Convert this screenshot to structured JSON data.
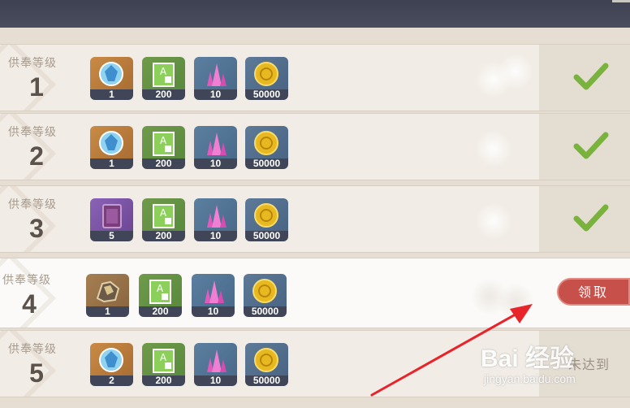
{
  "header": {
    "title": ""
  },
  "rows": [
    {
      "label": "供奉等级",
      "level": "1",
      "status": "claimed",
      "rewards": [
        {
          "icon": "blue-gem-icon",
          "qty": "1",
          "bg": "orange"
        },
        {
          "icon": "hero-wit-book-icon",
          "qty": "200",
          "bg": "blue"
        },
        {
          "icon": "crystal-icon",
          "qty": "10",
          "bg": "blue"
        },
        {
          "icon": "mora-coin-icon",
          "qty": "50000",
          "bg": "blue"
        }
      ]
    },
    {
      "label": "供奉等级",
      "level": "2",
      "status": "claimed",
      "rewards": [
        {
          "icon": "blue-gem-icon",
          "qty": "1",
          "bg": "orange"
        },
        {
          "icon": "hero-wit-book-icon",
          "qty": "200",
          "bg": "blue"
        },
        {
          "icon": "crystal-icon",
          "qty": "10",
          "bg": "blue"
        },
        {
          "icon": "mora-coin-icon",
          "qty": "50000",
          "bg": "blue"
        }
      ]
    },
    {
      "label": "供奉等级",
      "level": "3",
      "status": "claimed",
      "rewards": [
        {
          "icon": "purple-book-icon",
          "qty": "5",
          "bg": "purple"
        },
        {
          "icon": "hero-wit-book-icon",
          "qty": "200",
          "bg": "blue"
        },
        {
          "icon": "crystal-icon",
          "qty": "10",
          "bg": "blue"
        },
        {
          "icon": "mora-coin-icon",
          "qty": "50000",
          "bg": "blue"
        }
      ]
    },
    {
      "label": "供奉等级",
      "level": "4",
      "status": "claimable",
      "button": "领取",
      "rewards": [
        {
          "icon": "ore-icon",
          "qty": "1",
          "bg": "brown"
        },
        {
          "icon": "hero-wit-book-icon",
          "qty": "200",
          "bg": "blue"
        },
        {
          "icon": "crystal-icon",
          "qty": "10",
          "bg": "blue"
        },
        {
          "icon": "mora-coin-icon",
          "qty": "50000",
          "bg": "blue"
        }
      ]
    },
    {
      "label": "供奉等级",
      "level": "5",
      "status": "locked",
      "status_text": "未达到",
      "rewards": [
        {
          "icon": "blue-gem-icon",
          "qty": "2",
          "bg": "orange"
        },
        {
          "icon": "hero-wit-book-icon",
          "qty": "200",
          "bg": "blue"
        },
        {
          "icon": "crystal-icon",
          "qty": "10",
          "bg": "blue"
        },
        {
          "icon": "mora-coin-icon",
          "qty": "50000",
          "bg": "blue"
        }
      ]
    }
  ],
  "colors": {
    "check": "#79b33d",
    "claim_button": "#c8504a",
    "arrow": "#e8242b"
  },
  "watermark": {
    "logo": "Bai 经验",
    "url": "jingyan.baidu.com"
  }
}
